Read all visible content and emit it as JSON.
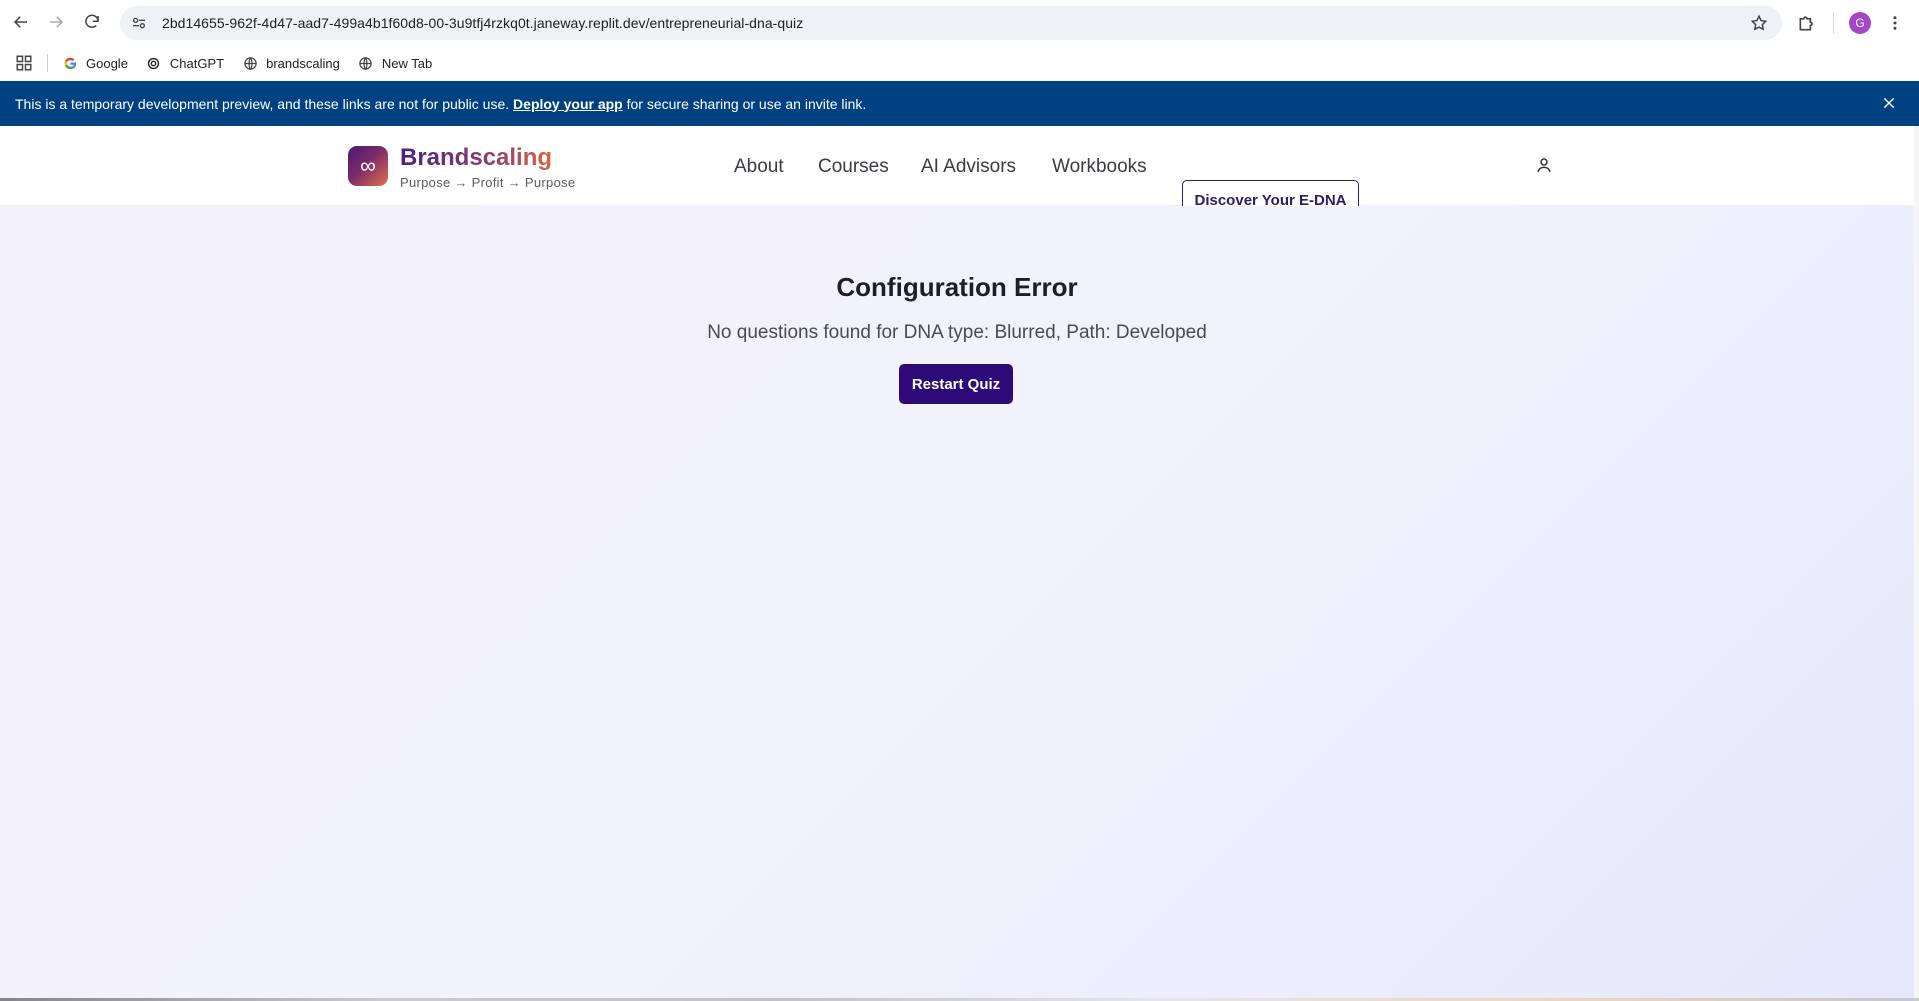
{
  "browser": {
    "url": "2bd14655-962f-4d47-aad7-499a4b1f60d8-00-3u9tfj4rzkq0t.janeway.replit.dev/entrepreneurial-dna-quiz",
    "avatar_letter": "G",
    "bookmarks": [
      {
        "label": "Google",
        "icon": "google-icon"
      },
      {
        "label": "ChatGPT",
        "icon": "chatgpt-icon"
      },
      {
        "label": "brandscaling",
        "icon": "globe-icon"
      },
      {
        "label": "New Tab",
        "icon": "globe-icon"
      }
    ]
  },
  "banner": {
    "text_before": "This is a temporary development preview, and these links are not for public use.",
    "link": "Deploy your app",
    "text_after": "for secure sharing or use an invite link."
  },
  "header": {
    "brand": "Brandscaling",
    "tagline": "Purpose → Profit → Purpose",
    "nav": [
      "About",
      "Courses",
      "AI Advisors",
      "Workbooks"
    ],
    "cta": "Discover Your E-DNA"
  },
  "main": {
    "title": "Configuration Error",
    "message": "No questions found for DNA type: Blurred, Path: Developed",
    "button": "Restart Quiz"
  },
  "colors": {
    "banner_bg": "#004182",
    "primary_button": "#2e0a78",
    "brand_gradient_start": "#4b1f7d",
    "brand_gradient_end": "#d8663f",
    "avatar": "#a347c7"
  }
}
